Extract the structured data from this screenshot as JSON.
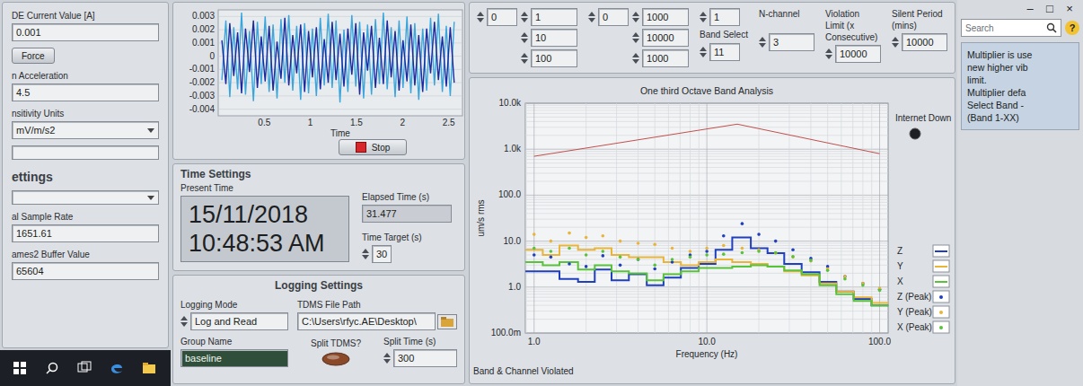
{
  "window": {
    "controls": [
      "–",
      "□",
      "×"
    ]
  },
  "left_panel": {
    "items": [
      {
        "kind": "field",
        "label": "DE Current Value [A]",
        "value": "0.001"
      },
      {
        "kind": "button",
        "label": "Force"
      },
      {
        "kind": "field",
        "label": "n Acceleration",
        "value": "4.5"
      },
      {
        "kind": "dropdown",
        "label": "nsitivity Units",
        "value": "mV/m/s2"
      },
      {
        "kind": "blank"
      },
      {
        "kind": "heading",
        "label": "ettings"
      },
      {
        "kind": "blank-dropdown"
      },
      {
        "kind": "field",
        "label": "al Sample Rate",
        "value": "1651.61"
      },
      {
        "kind": "field",
        "label": "ames2 Buffer Value",
        "value": "65604"
      }
    ]
  },
  "waveform": {
    "x_label": "Time",
    "x_ticks": [
      "0.5",
      "1",
      "1.5",
      "2",
      "2.5"
    ],
    "y_ticks": [
      "0.003",
      "0.002",
      "0.001",
      "0",
      "-0.001",
      "-0.002",
      "-0.003",
      "-0.004"
    ],
    "series": [
      {
        "color": "#3aa6dc",
        "values": [
          -0.0018,
          0.0027,
          -0.0031,
          0.0022,
          -0.0025,
          0.0033,
          -0.0029,
          0.0019,
          -0.0034,
          0.0026,
          -0.0021,
          0.003,
          -0.0027,
          0.0024,
          -0.0032,
          0.0028,
          -0.002,
          0.0031,
          -0.0026,
          0.0023,
          -0.0033,
          0.0025,
          -0.0028,
          0.0021,
          -0.003,
          0.0029,
          -0.0022,
          0.0032,
          -0.0024,
          0.0027,
          -0.0035,
          0.002,
          -0.0027,
          0.0031,
          -0.0023,
          0.0026,
          -0.0032,
          0.0024,
          -0.0029,
          0.0028,
          -0.0021,
          0.0033,
          -0.0025,
          0.0022,
          -0.0031,
          0.0027,
          -0.0024,
          0.003,
          -0.0028,
          0.0025,
          -0.0033,
          0.0021,
          -0.0026,
          0.0029,
          -0.0022,
          0.0032,
          -0.0027,
          0.0023,
          -0.003,
          0.0026
        ]
      },
      {
        "color": "#1c2aa0",
        "values": [
          0.0012,
          -0.0021,
          0.0025,
          -0.0015,
          0.0018,
          -0.0028,
          0.0021,
          -0.0012,
          0.0027,
          -0.0024,
          0.0015,
          -0.0019,
          0.0023,
          -0.0026,
          0.0011,
          -0.0017,
          0.0029,
          -0.0022,
          0.0016,
          -0.0013,
          0.0024,
          -0.0027,
          0.0019,
          -0.0016,
          0.0022,
          -0.0025,
          0.0013,
          -0.002,
          0.0026,
          -0.0018,
          0.0017,
          -0.0023,
          0.0021,
          -0.0014,
          0.0025,
          -0.0029,
          0.0018,
          -0.0011,
          0.0023,
          -0.0024,
          0.0014,
          -0.0021,
          0.0027,
          -0.0016,
          0.0019,
          -0.0026,
          0.0012,
          -0.0019,
          0.0024,
          -0.0022,
          0.0016,
          -0.0027,
          0.0021,
          -0.0013,
          0.0026,
          -0.0018,
          0.0015,
          -0.0023,
          0.0022,
          -0.002
        ]
      }
    ],
    "stop_button": "Stop"
  },
  "time_settings": {
    "title": "Time Settings",
    "present_label": "Present Time",
    "date": "15/11/2018",
    "time": "10:48:53 AM",
    "elapsed_label": "Elapsed Time (s)",
    "elapsed": "31.477",
    "target_label": "Time Target (s)",
    "target": "30"
  },
  "logging": {
    "title": "Logging Settings",
    "mode_label": "Logging Mode",
    "mode": "Log and Read",
    "path_label": "TDMS File Path",
    "path": "C:\\Users\\rfyc.AE\\Desktop\\",
    "group_label": "Group Name",
    "group": "baseline",
    "group_highlighted": true,
    "split_label": "Split TDMS?",
    "split_on": false,
    "split_time_label": "Split Time (s)",
    "split_time": "300"
  },
  "top_controls": {
    "arrays": [
      {
        "index": "0",
        "values": [
          "1",
          "10",
          "100"
        ]
      },
      {
        "index": "0",
        "values": [
          "1000",
          "10000",
          "1000"
        ]
      }
    ],
    "band_select": {
      "index": "1",
      "label": "Band Select",
      "value": "11"
    },
    "settings": [
      {
        "label": "N-channel",
        "value": "3"
      },
      {
        "label": "Violation Limit (x Consecutive)",
        "value": "10000"
      },
      {
        "label": "Silent Period (mins)",
        "value": "10000"
      }
    ]
  },
  "search": {
    "placeholder": "Search",
    "help": "?"
  },
  "notes": [
    "Multiplier is use",
    "new higher vib",
    "limit.",
    "Multiplier defa",
    "Select Band -",
    "(Band 1-XX)"
  ],
  "octave": {
    "title": "One third Octave Band Analysis",
    "y_label": "um/s rms",
    "x_label": "Frequency (Hz)",
    "y_ticks": [
      "10.0k",
      "1.0k",
      "100.0",
      "10.0",
      "1.0",
      "100.0m"
    ],
    "x_ticks": [
      "1.0",
      "10.0",
      "100.0"
    ],
    "bands": [
      1,
      1.25,
      1.6,
      2,
      2.5,
      3.15,
      4,
      5,
      6.3,
      8,
      10,
      12.5,
      16,
      20,
      25,
      31.5,
      40,
      50,
      63,
      80,
      100
    ],
    "series": [
      {
        "name": "Z",
        "peak_label": "Z (Peak)",
        "color": "#1f3fbf",
        "values": [
          2.2,
          2.2,
          1.5,
          1.3,
          2.4,
          1.4,
          1.9,
          1.1,
          1.6,
          2.6,
          3.2,
          6.5,
          12,
          7,
          5.5,
          3.2,
          2.1,
          1.3,
          0.8,
          0.55,
          0.4
        ],
        "peaks": [
          5,
          4.5,
          3.2,
          2.8,
          4.8,
          3,
          4,
          2.5,
          3.5,
          5,
          6,
          13,
          24,
          14,
          10,
          6.5,
          4.2,
          2.8,
          1.7,
          1.2,
          0.9
        ]
      },
      {
        "name": "Y",
        "peak_label": "Y (Peak)",
        "color": "#e8b43a",
        "values": [
          6.5,
          5,
          8,
          6.5,
          7,
          5,
          4.5,
          4.5,
          3.5,
          3,
          3.5,
          4,
          3.5,
          3.2,
          2.8,
          2.2,
          1.8,
          1.2,
          0.8,
          0.6,
          0.45
        ],
        "peaks": [
          14,
          10,
          15,
          12,
          13,
          10,
          9,
          8.5,
          7,
          6,
          7,
          8,
          7,
          6.5,
          5.5,
          4.5,
          3.7,
          2.5,
          1.7,
          1.2,
          0.95
        ]
      },
      {
        "name": "X",
        "peak_label": "X (Peak)",
        "color": "#58c23a",
        "values": [
          3.5,
          3,
          3.5,
          2.4,
          3,
          2.2,
          2,
          1.4,
          1.9,
          2.2,
          2.6,
          2.6,
          2.8,
          3,
          2.8,
          2.3,
          1.9,
          1.1,
          0.7,
          0.5,
          0.4
        ],
        "peaks": [
          7,
          6,
          7,
          5,
          6,
          4.5,
          4,
          3,
          4,
          4.5,
          5,
          5.2,
          5.6,
          6,
          5.6,
          4.6,
          3.8,
          2.3,
          1.5,
          1.1,
          0.85
        ]
      }
    ],
    "limit": {
      "color": "#c0504d",
      "freqs": [
        1,
        15,
        100
      ],
      "values": [
        700,
        3500,
        800
      ]
    },
    "indicator": {
      "label": "Internet Down",
      "on": false
    },
    "footer_label": "Band & Channel Violated"
  }
}
